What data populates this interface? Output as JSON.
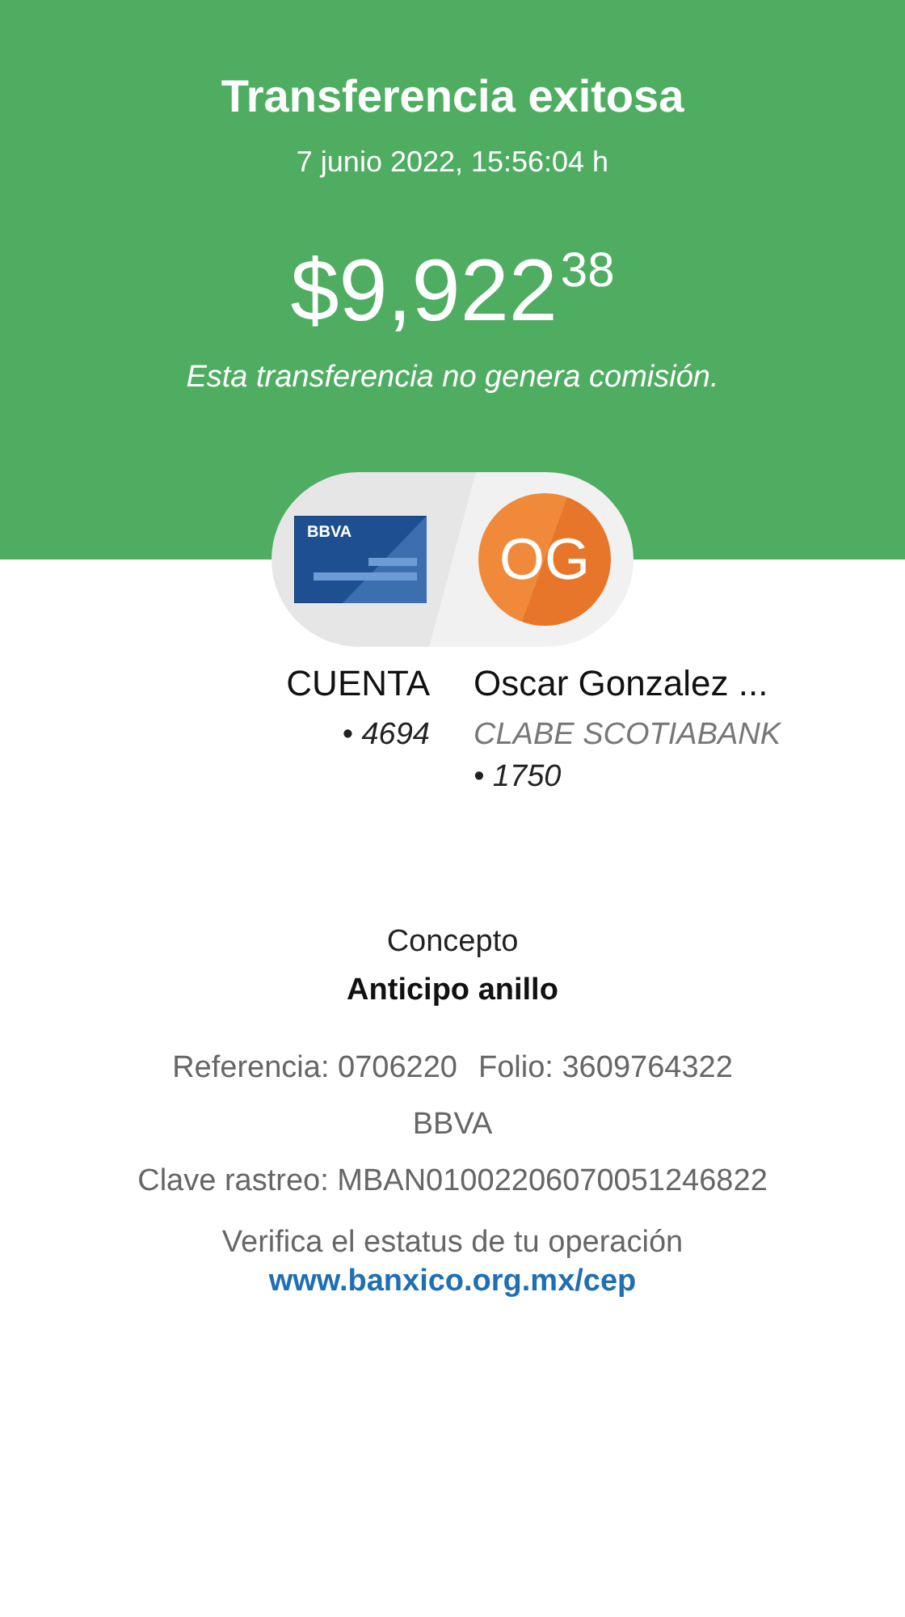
{
  "header": {
    "title": "Transferencia exitosa",
    "datetime": "7 junio 2022, 15:56:04 h",
    "amount": "$9,922",
    "amount_cents": "38",
    "note": "Esta transferencia no genera comisión."
  },
  "origin": {
    "card_logo": "BBVA",
    "name": "CUENTA",
    "lines": [
      "• 4694"
    ]
  },
  "destination": {
    "initials": "OG",
    "name": "Oscar Gonzalez ...",
    "lines": [
      "CLABE SCOTIABANK",
      "• 1750"
    ]
  },
  "concept": {
    "label": "Concepto",
    "value": "Anticipo anillo"
  },
  "details": [
    {
      "kind": "pair",
      "parts": [
        "Referencia: 0706220",
        "Folio: 3609764322"
      ]
    },
    {
      "kind": "line",
      "parts": [
        "BBVA"
      ]
    },
    {
      "kind": "line",
      "parts": [
        "Clave rastreo: MBAN01002206070051246822"
      ]
    }
  ],
  "verify": {
    "text": "Verifica el estatus de tu operación",
    "link": "www.banxico.org.mx/cep"
  }
}
